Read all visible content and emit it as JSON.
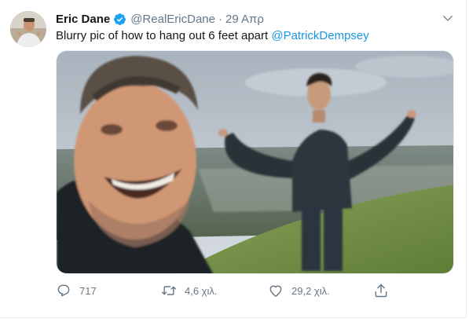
{
  "tweet": {
    "author_name": "Eric Dane",
    "handle": "@RealEricDane",
    "separator": "·",
    "date": "29 Απρ",
    "text_before": "Blurry pic of how to hang out 6 feet apart ",
    "mention": "@PatrickDempsey",
    "media_description_alt": "Blurry selfie on a grassy hill"
  },
  "actions": {
    "reply_count": "717",
    "retweet_count": "4,6 χιλ.",
    "like_count": "29,2 χιλ."
  },
  "icons": {
    "verified": "verified-badge-icon",
    "chevron": "chevron-down-icon",
    "reply": "reply-icon",
    "retweet": "retweet-icon",
    "like": "heart-icon",
    "share": "share-icon"
  },
  "colors": {
    "link": "#1b95e0",
    "secondary_text": "#657786",
    "verified": "#1da1f2"
  }
}
